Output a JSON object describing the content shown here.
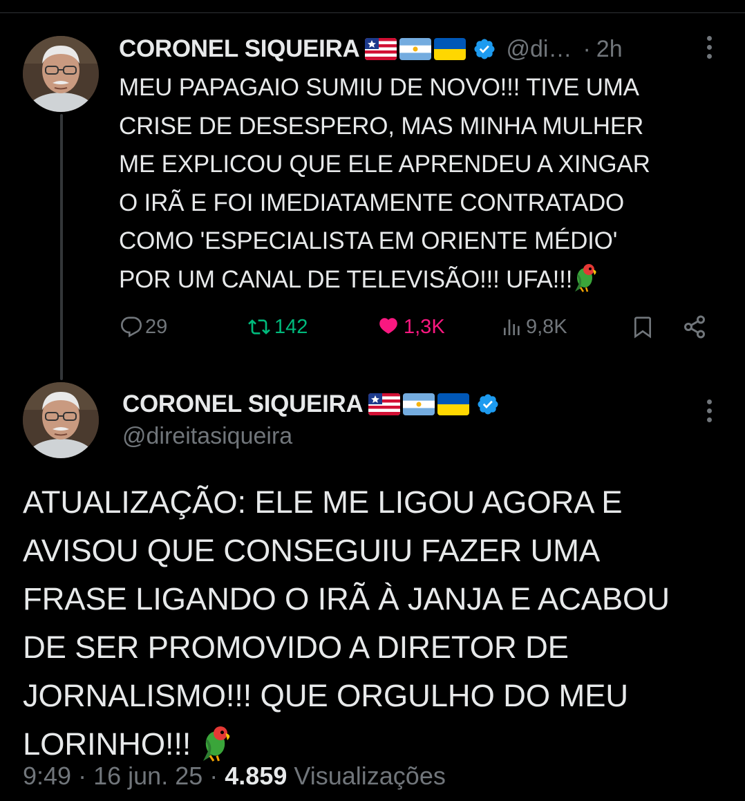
{
  "colors": {
    "background": "#000000",
    "text": "#e7e9ea",
    "muted": "#71767b",
    "retweet": "#00ba7c",
    "like": "#f91880",
    "verified": "#1d9bf0"
  },
  "tweet1": {
    "author_name": "CORONEL SIQUEIRA",
    "flags": [
      "maranhao-flag",
      "argentina-flag",
      "ukraine-flag"
    ],
    "handle": "@di…",
    "separator": "·",
    "time": "2h",
    "text": "MEU PAPAGAIO SUMIU DE NOVO!!! TIVE UMA\nCRISE DE DESESPERO, MAS MINHA MULHER\nME EXPLICOU QUE ELE APRENDEU A XINGAR\nO IRÃ E FOI IMEDIATAMENTE CONTRATADO\nCOMO 'ESPECIALISTA EM ORIENTE MÉDIO'\nPOR UM CANAL DE TELEVISÃO!!! UFA!!!",
    "emoji": "parrot-icon",
    "replies": "29",
    "retweets": "142",
    "likes": "1,3K",
    "views": "9,8K"
  },
  "tweet2": {
    "author_name": "CORONEL SIQUEIRA",
    "flags": [
      "maranhao-flag",
      "argentina-flag",
      "ukraine-flag"
    ],
    "handle": "@direitasiqueira",
    "text": "ATUALIZAÇÃO: ELE ME LIGOU AGORA E\nAVISOU QUE CONSEGUIU FAZER UMA\nFRASE LIGANDO O IRÃ À JANJA E ACABOU\nDE SER PROMOVIDO A DIRETOR DE\nJORNALISMO!!! QUE ORGULHO DO MEU\nLORINHO!!!",
    "emoji": "parrot-icon",
    "time": "9:49",
    "date": "16 jun. 25",
    "separator": "·",
    "views_count": "4.859",
    "views_label": "Visualizações"
  }
}
